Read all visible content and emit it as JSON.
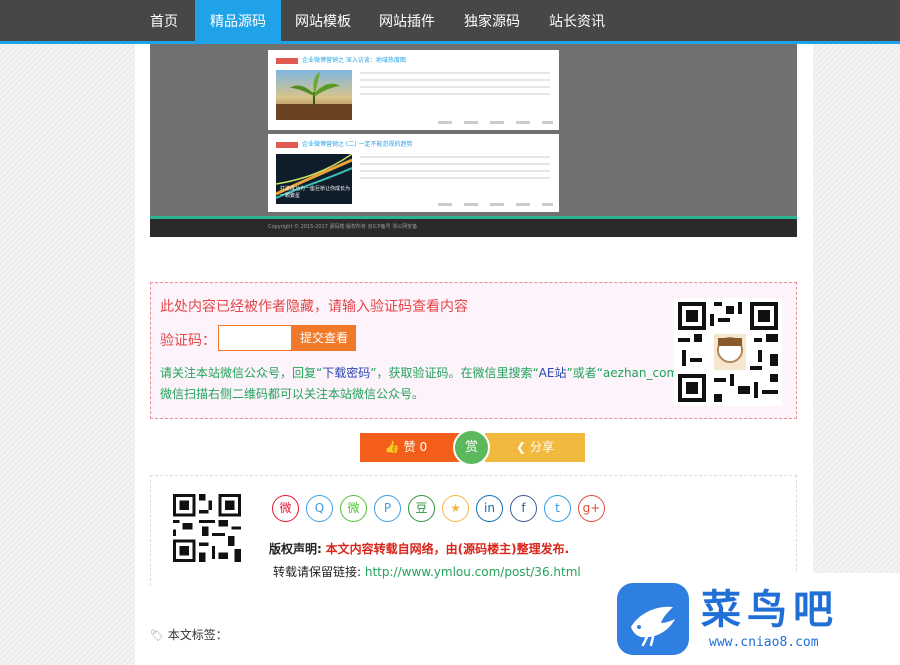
{
  "nav": {
    "items": [
      {
        "label": "首页",
        "active": false
      },
      {
        "label": "精品源码",
        "active": true
      },
      {
        "label": "网站模板",
        "active": false
      },
      {
        "label": "网站插件",
        "active": false
      },
      {
        "label": "独家源码",
        "active": false
      },
      {
        "label": "站长资讯",
        "active": false
      }
    ],
    "accent": "#20a2e8",
    "background": "#474747"
  },
  "preview": {
    "cards": [
      {
        "title": "企业微博营销之 深入访谈：地域热度图"
      },
      {
        "title": "企业微博营销之 (二) 一定不能忽视的趋势"
      }
    ],
    "thumb_caption": "打造成功为一座巨桥让你成长为一颗繁星",
    "footer": "Copyright © 2015-2017 源码楼 版权所有 京ICP备号 浙公网安备"
  },
  "hidden_content": {
    "title": "此处内容已经被作者隐藏，请输入验证码查看内容",
    "code_label": "验证码：",
    "code_value": "",
    "submit_label": "提交查看",
    "notice_1": "请关注本站微信公众号，回复“",
    "notice_keyword": "下载密码",
    "notice_2": "”，获取验证码。在微信里搜索“",
    "notice_account": "AE站",
    "notice_3": "”或者“",
    "notice_id": "aezhan_com",
    "notice_4": "”或者微信扫描右侧二维码都可以关注本站微信公众号。"
  },
  "actions": {
    "like_label": "赞 0",
    "reward_label": "赏",
    "share_label": "分享"
  },
  "share": {
    "icons": [
      {
        "name": "weibo-icon",
        "glyph": "微",
        "color": "#e6162d"
      },
      {
        "name": "qq-icon",
        "glyph": "Q",
        "color": "#3c9fe0"
      },
      {
        "name": "wechat-icon",
        "glyph": "微",
        "color": "#51c332"
      },
      {
        "name": "pinterest-icon",
        "glyph": "P",
        "color": "#3c9fe0"
      },
      {
        "name": "douban-icon",
        "glyph": "豆",
        "color": "#2e963d"
      },
      {
        "name": "qzone-icon",
        "glyph": "★",
        "color": "#f2b93f"
      },
      {
        "name": "linkedin-icon",
        "glyph": "in",
        "color": "#0b6fb0"
      },
      {
        "name": "facebook-icon",
        "glyph": "f",
        "color": "#3b5998"
      },
      {
        "name": "twitter-icon",
        "glyph": "t",
        "color": "#2a9de8"
      },
      {
        "name": "googleplus-icon",
        "glyph": "g+",
        "color": "#dd4b39"
      }
    ],
    "copyright_label": "版权声明:",
    "copyright_text": "本文内容转载自网络，由(源码楼主)整理发布.",
    "repost_label": "转载请保留链接:",
    "repost_url": "http://www.ymlou.com/post/36.html"
  },
  "tags": {
    "label": "本文标签："
  },
  "watermark": {
    "name": "菜鸟吧",
    "url": "www.cniao8.com"
  }
}
